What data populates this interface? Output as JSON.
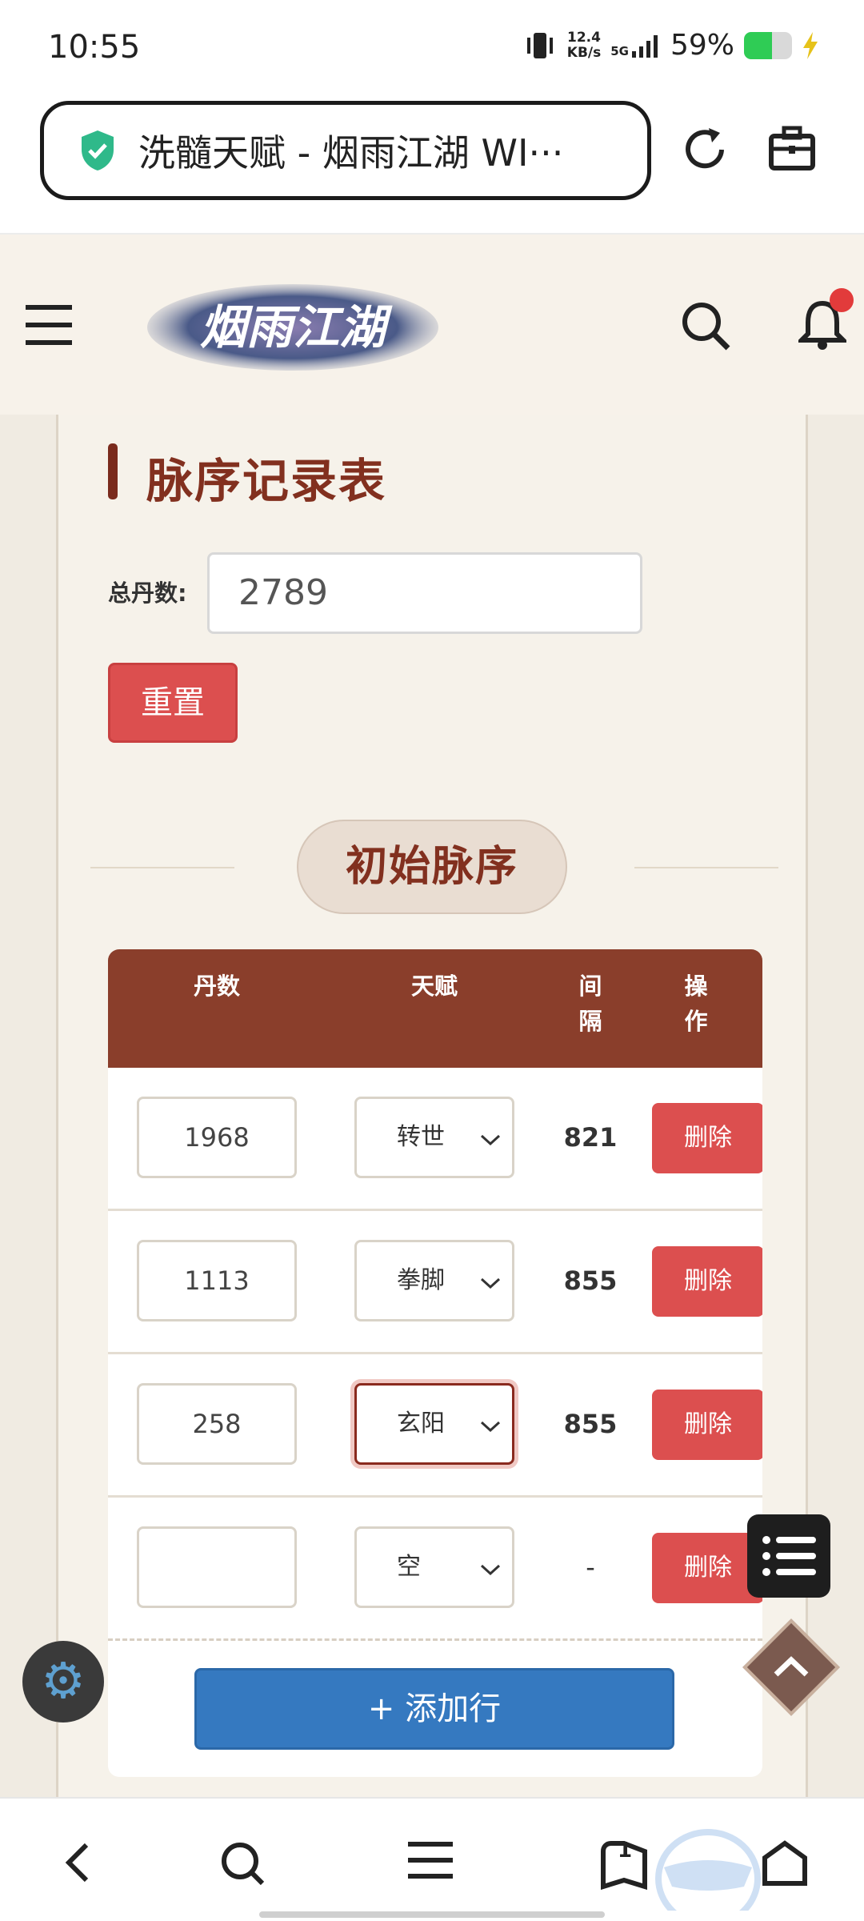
{
  "status": {
    "time": "10:55",
    "net_speed": "12.4",
    "net_unit": "KB/s",
    "signal": "5G",
    "battery": "59%"
  },
  "browser": {
    "url_title": "洗髓天赋 - 烟雨江湖 WI···",
    "tab_count": "1"
  },
  "header": {
    "logo_text": "烟雨江湖"
  },
  "page": {
    "section_title": "脉序记录表",
    "total_label": "总丹数:",
    "total_value": "2789",
    "reset_label": "重置",
    "group_title": "初始脉序",
    "add_row_label": "+ 添加行"
  },
  "table": {
    "headers": {
      "dan": "丹数",
      "talent": "天赋",
      "gap_1": "间",
      "gap_2": "隔",
      "op_1": "操",
      "op_2": "作"
    },
    "rows": [
      {
        "dan": "1968",
        "talent": "转世",
        "gap": "821",
        "action": "删除"
      },
      {
        "dan": "1113",
        "talent": "拳脚",
        "gap": "855",
        "action": "删除"
      },
      {
        "dan": "258",
        "talent": "玄阳",
        "gap": "855",
        "action": "删除"
      },
      {
        "dan": "",
        "talent": "空",
        "gap": "-",
        "action": "删除"
      }
    ]
  },
  "colors": {
    "accent": "#82301f",
    "danger": "#dc4f4f",
    "primary": "#3579c0",
    "header": "#8a3e2b"
  }
}
